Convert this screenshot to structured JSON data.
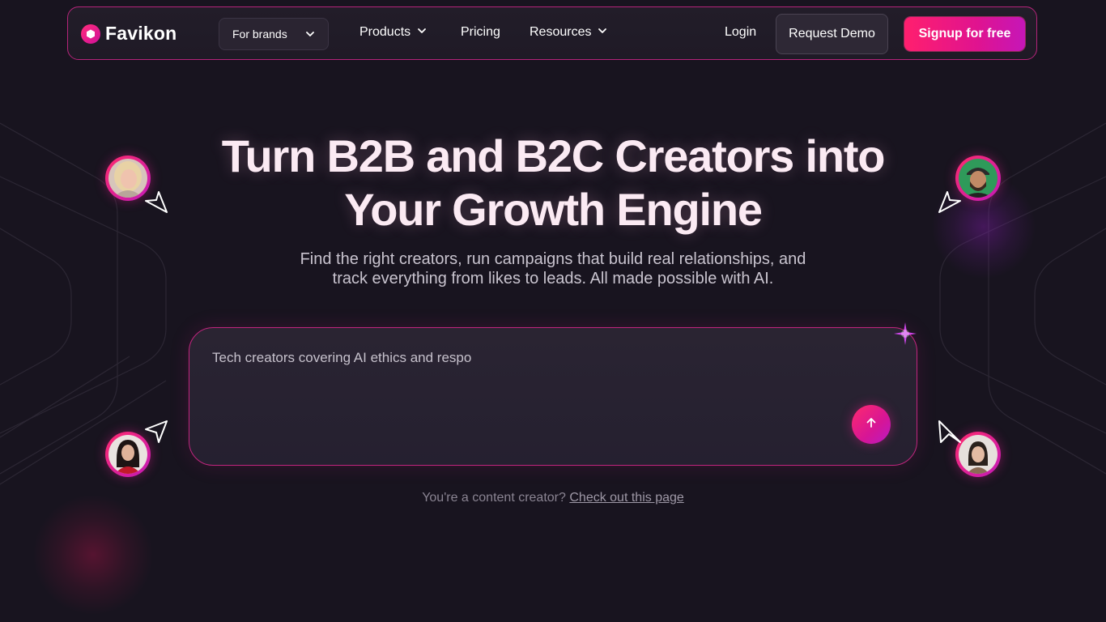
{
  "nav": {
    "logo_text": "Favikon",
    "audience_dropdown": "For brands",
    "links": {
      "products": "Products",
      "pricing": "Pricing",
      "resources": "Resources"
    },
    "login": "Login",
    "request_demo": "Request Demo",
    "signup": "Signup for free"
  },
  "hero": {
    "title_line1": "Turn B2B and B2C Creators into",
    "title_line2": "Your Growth Engine",
    "subtitle_line1": "Find the right creators, run campaigns that build real relationships, and",
    "subtitle_line2": "track everything from likes to leads. All made possible with AI."
  },
  "prompt": {
    "value": "Tech creators covering AI ethics and respo",
    "send_icon": "arrow-up-icon"
  },
  "footer": {
    "question": "You're a content creator?",
    "link": "Check out this page"
  },
  "avatars": {
    "icon_names": [
      "creator-avatar-blonde",
      "creator-avatar-bearded",
      "creator-avatar-red-dress",
      "creator-avatar-dark-hair"
    ]
  },
  "colors": {
    "background": "#18141f",
    "accent_pink": "#ff1f6e",
    "accent_magenta": "#c516b8",
    "title_text": "#fbeaf3"
  }
}
